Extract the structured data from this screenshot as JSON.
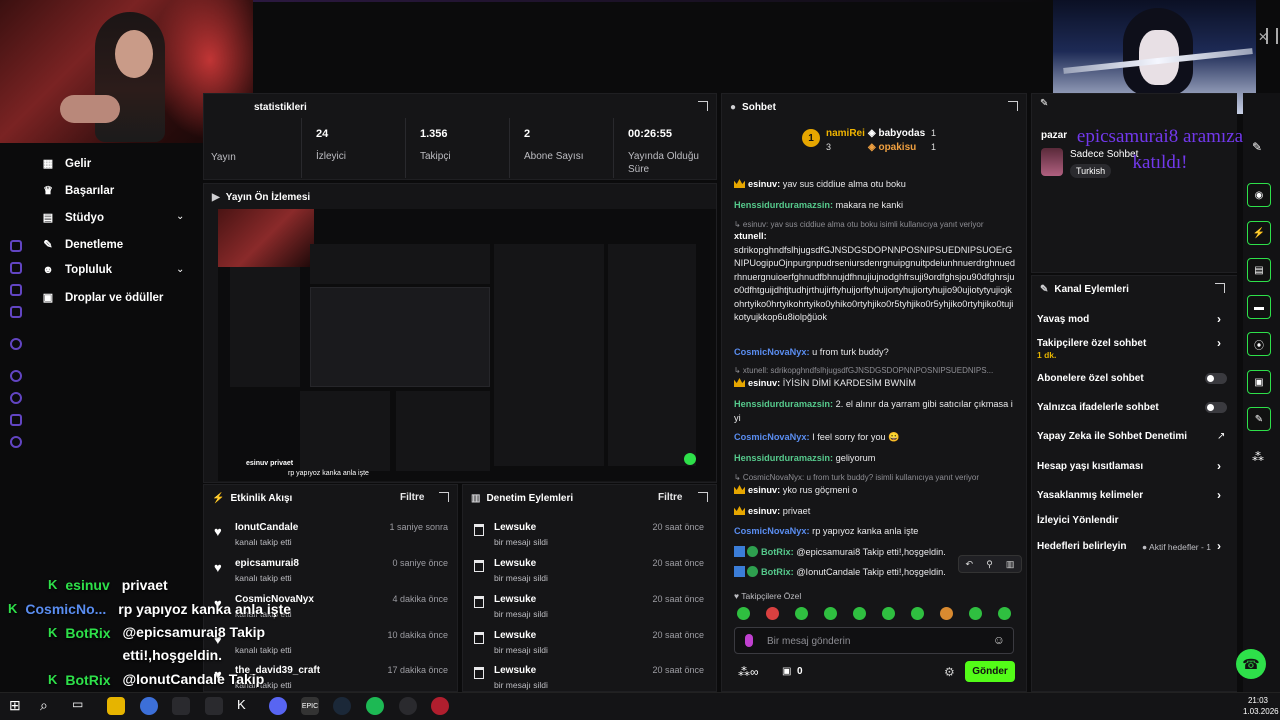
{
  "nav": {
    "items": [
      "Gelir",
      "Başarılar",
      "Stüdyo",
      "Denetleme",
      "Topluluk",
      "Droplar ve ödüller"
    ]
  },
  "stats": {
    "title": "statistikleri",
    "items": [
      {
        "value": "",
        "label": "Yayın"
      },
      {
        "value": "24",
        "label": "İzleyici"
      },
      {
        "value": "1.356",
        "label": "Takipçi"
      },
      {
        "value": "2",
        "label": "Abone Sayısı"
      },
      {
        "value": "00:26:55",
        "label": "Yayında Olduğu Süre"
      }
    ]
  },
  "preview": {
    "title": "Yayın Ön İzlemesi",
    "overlay_user": "esinuv privaet",
    "overlay_msg": "rp yapıyoz kanka anla işte"
  },
  "activity": {
    "title": "Etkinlik Akışı",
    "filter": "Filtre",
    "rows": [
      {
        "name": "IonutCandale",
        "sub": "kanalı takip etti",
        "time": "1 saniye sonra"
      },
      {
        "name": "epicsamurai8",
        "sub": "kanalı takip etti",
        "time": "0 saniye önce"
      },
      {
        "name": "CosmicNovaNyx",
        "sub": "kanalı takip etti",
        "time": "4 dakika önce"
      },
      {
        "name": "",
        "sub": "kanalı takip etti",
        "time": "10 dakika önce"
      },
      {
        "name": "the_david39_craft",
        "sub": "kanalı takip etti",
        "time": "17 dakika önce"
      }
    ]
  },
  "modlog": {
    "title": "Denetim Eylemleri",
    "filter": "Filtre",
    "rows": [
      {
        "name": "Lewsuke",
        "sub": "bir mesajı sildi",
        "time": "20 saat önce"
      },
      {
        "name": "Lewsuke",
        "sub": "bir mesajı sildi",
        "time": "20 saat önce"
      },
      {
        "name": "Lewsuke",
        "sub": "bir mesajı sildi",
        "time": "20 saat önce"
      },
      {
        "name": "Lewsuke",
        "sub": "bir mesajı sildi",
        "time": "20 saat önce"
      },
      {
        "name": "Lewsuke",
        "sub": "bir mesajı sildi",
        "time": "20 saat önce"
      }
    ]
  },
  "chat": {
    "title": "Sohbet",
    "leaders": [
      {
        "rank": "1",
        "name": "namiRei",
        "count": "3"
      },
      {
        "rank": "",
        "name": "babyodas",
        "count": "1"
      },
      {
        "rank": "",
        "name": "opakisu",
        "count": "1"
      }
    ],
    "messages": [
      {
        "user": "esinuv",
        "text": "yav sus ciddiue alma otu boku",
        "style": "gold",
        "reply": ""
      },
      {
        "user": "Henssidurduramazsin",
        "text": "makara ne kanki",
        "style": "green",
        "reply": ""
      },
      {
        "user": "xtunell",
        "text": "sdrikopghndfslhjugsdfGJNSDGSDOPNNPOSNIPSUEDNIPSUOErGNIPUogipuOjnpurgnpudrseniursdenrgnuipgnuitpdeiunhnuerdrghnuedrhnuergnuioerfghnudfbhnujdfhnujiujnodghfrsuji9ordfghsjou90dfghrsjuo0dfhtguijdhtjtudhjrthujirftyhuijorftyhuijortyhujiortyhujio90ujiotytyujiojkohrtyiko0hrtyikohrtyiko0yhiko0rtyhjiko0r5tyhjiko0r5yhjiko0rtyhjiko0tujikotyujkkop6u8iolpğüok",
        "style": "white",
        "reply": "esinuv: yav sus ciddiue alma otu boku isimli kullanıcıya yanıt veriyor"
      },
      {
        "user": "CosmicNovaNyx",
        "text": "u from turk buddy?",
        "style": "blue",
        "reply": ""
      },
      {
        "user": "esinuv",
        "text": "İYİSİN DİMİ KARDESİM BWNİM",
        "style": "gold",
        "reply": "xtunell: sdrikopghndfslhjugsdfGJNSDGSDOPNNPOSNIPSUEDNIPS..."
      },
      {
        "user": "Henssidurduramazsin",
        "text": "2. el alınır da yarram gibi satıcılar çıkmasa iyi",
        "style": "green",
        "reply": ""
      },
      {
        "user": "CosmicNovaNyx",
        "text": "I feel sorry for you 😀",
        "style": "blue",
        "reply": ""
      },
      {
        "user": "Henssidurduramazsin",
        "text": "geliyorum",
        "style": "green",
        "reply": ""
      },
      {
        "user": "esinuv",
        "text": "yko rus göçmeni o",
        "style": "gold",
        "reply": "CosmicNovaNyx: u from turk buddy? isimli kullanıcıya yanıt veriyor"
      },
      {
        "user": "esinuv",
        "text": "privaet",
        "style": "gold",
        "reply": ""
      },
      {
        "user": "CosmicNovaNyx",
        "text": "rp yapıyoz kanka anla işte",
        "style": "blue",
        "reply": ""
      },
      {
        "user": "BotRix",
        "text": "@epicsamurai8 Takip etti!,hoşgeldin.",
        "style": "bot",
        "reply": ""
      },
      {
        "user": "BotRix",
        "text": "@IonutCandale Takip etti!,hoşgeldin.",
        "style": "bot",
        "reply": ""
      }
    ],
    "followers_only": "Takipçilere Özel",
    "placeholder": "Bir mesaj gönderin",
    "points": "0",
    "send": "Gönder"
  },
  "right": {
    "user_prefix": "pazar",
    "status": "Sadece Sohbet",
    "language": "Turkish",
    "overlay_text": "epicsamurai8 aramıza katıldı!",
    "actions_title": "Kanal Eylemleri",
    "actions": [
      {
        "label": "Yavaş mod",
        "note": "",
        "ctrl": "chev"
      },
      {
        "label": "Takipçilere özel sohbet",
        "note": "1 dk.",
        "ctrl": "chev"
      },
      {
        "label": "Abonelere özel sohbet",
        "note": "",
        "ctrl": "toggle"
      },
      {
        "label": "Yalnızca ifadelerle sohbet",
        "note": "",
        "ctrl": "toggle"
      },
      {
        "label": "Yapay Zeka ile Sohbet Denetimi",
        "note": "",
        "ctrl": "ext"
      },
      {
        "label": "Hesap yaşı kısıtlaması",
        "note": "",
        "ctrl": "chev"
      },
      {
        "label": "Yasaklanmış kelimeler",
        "note": "",
        "ctrl": "chev"
      },
      {
        "label": "İzleyici Yönlendir",
        "note": "",
        "ctrl": ""
      },
      {
        "label": "Hedefleri belirleyin",
        "note": "Aktif hedefler - 1",
        "ctrl": "chev"
      }
    ]
  },
  "overlay_chat": [
    {
      "user": "esinuv",
      "text": "privaet",
      "style": "n"
    },
    {
      "user": "CosmicNo...",
      "text": "rp yapıyoz kanka anla işte",
      "style": "n2"
    },
    {
      "user": "BotRix",
      "text": "@epicsamurai8 Takip etti!,hoşgeldin.",
      "style": "n"
    },
    {
      "user": "BotRix",
      "text": "@IonutCandale Takip etti!,hoşgeldin.",
      "style": "n"
    }
  ],
  "clock": {
    "time": "21:03",
    "date": "1.03.2026"
  },
  "colors": {
    "accent": "#53fc18",
    "chat_green": "#56c98c",
    "chat_blue": "#5a8df0",
    "gold": "#e6a600"
  }
}
